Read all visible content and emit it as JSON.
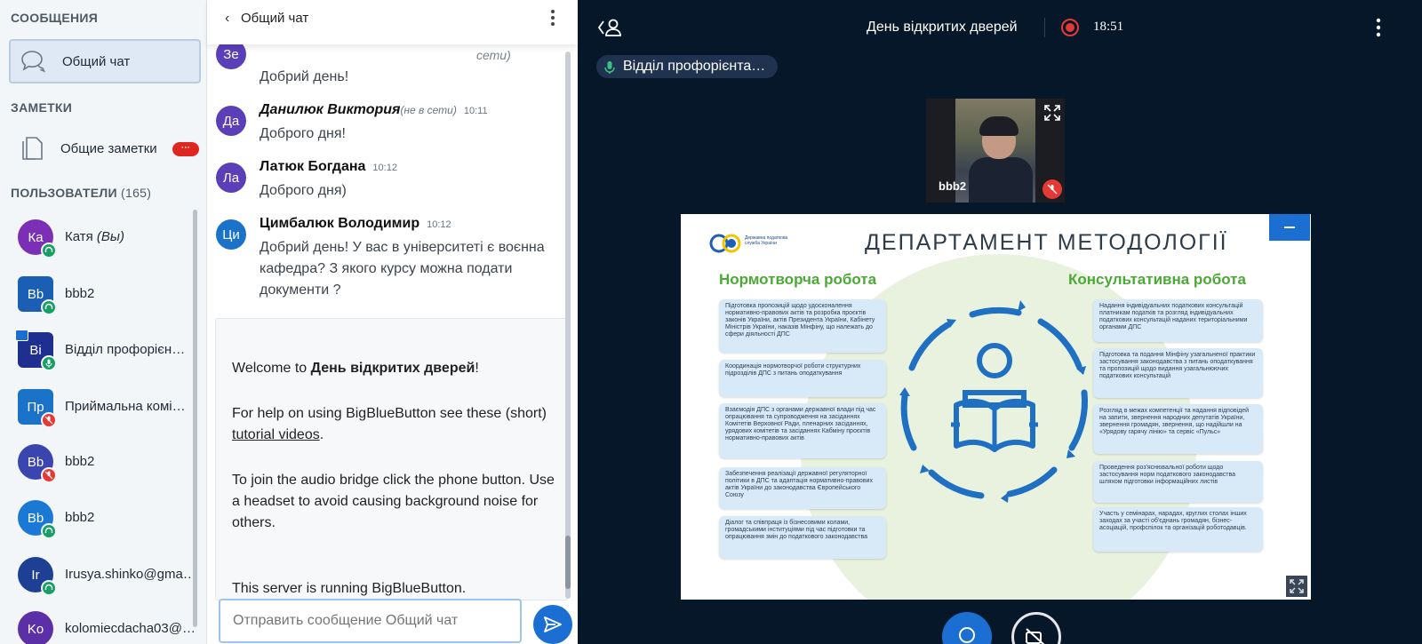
{
  "sidebar": {
    "messages_title": "СООБЩЕНИЯ",
    "public_chat": "Общий чат",
    "notes_title": "ЗАМЕТКИ",
    "shared_notes": "Общие заметки",
    "notes_badge": "···",
    "users_title": "ПОЛЬЗОВАТЕЛИ",
    "users_count": "(165)",
    "users": [
      {
        "initials": "Ка",
        "name": "Катя",
        "suffix": "(Вы)",
        "color": "#7b2fb5"
      },
      {
        "initials": "Bb",
        "name": "bbb2",
        "suffix": "",
        "color": "#1a5fb4"
      },
      {
        "initials": "Ві",
        "name": "Відділ профорієн…",
        "suffix": "",
        "color": "#1f2f8f"
      },
      {
        "initials": "Пр",
        "name": "Приймальна комі…",
        "suffix": "",
        "color": "#1a73c8"
      },
      {
        "initials": "Bb",
        "name": "bbb2",
        "suffix": "",
        "color": "#3b45b0"
      },
      {
        "initials": "Bb",
        "name": "bbb2",
        "suffix": "",
        "color": "#1b79d6"
      },
      {
        "initials": "Ir",
        "name": "Irusya.shinko@gma…",
        "suffix": "",
        "color": "#1d3f94"
      },
      {
        "initials": "Ko",
        "name": "kolomiecdacha03@…",
        "suffix": "",
        "color": "#5b2fa5"
      }
    ]
  },
  "chat": {
    "title": "Общий чат",
    "messages": [
      {
        "initials": "Зе",
        "author": "",
        "offline": "сети)",
        "time": "",
        "lines": [
          "Добрий день!"
        ]
      },
      {
        "initials": "Да",
        "author": "Данилюк Виктория",
        "offline": "(не в сети)",
        "time": "10:11",
        "lines": [
          "Доброго дня!"
        ]
      },
      {
        "initials": "Ла",
        "author": "Латюк Богдана",
        "offline": "",
        "time": "10:12",
        "lines": [
          "Доброго дня)"
        ]
      },
      {
        "initials": "Ци",
        "author": "Цимбалюк Володимир",
        "offline": "",
        "time": "10:12",
        "lines": [
          "Добрий день! У вас в університеті є воєнна",
          "кафедра? З якого курсу можна подати",
          "документи ?"
        ]
      }
    ],
    "welcome": {
      "w1a": "Welcome to ",
      "w1b": "День відкритих дверей",
      "w1c": "!",
      "w2a": "For help on using BigBlueButton see these (short) ",
      "w2b": "tutorial videos",
      "w2c": ".",
      "w3": "To join the audio bridge click the phone button. Use a headset to avoid causing background noise for others.",
      "w4": "This server is running BigBlueButton."
    },
    "input_placeholder": "Отправить сообщение Общий чат"
  },
  "main": {
    "meeting_title": "День відкритих дверей",
    "time": "18:51",
    "talker": "Відділ профорієнта…",
    "camera_name": "bbb2"
  },
  "slide": {
    "logo_text": "Державна податкова служба України",
    "title": "ДЕПАРТАМЕНТ МЕТОДОЛОГІЇ",
    "left_heading": "Нормотворча робота",
    "right_heading": "Консультативна робота",
    "left_boxes": [
      "Підготовка пропозицій щодо удосконалення нормативно-правових актів та розробка проєктів законів України, актів Президента України, Кабінету Міністрів України, наказів Мінфіну, що належать до сфери діяльності ДПС",
      "Координація нормотворчої роботи структурних підрозділів ДПС з питань оподаткування",
      "Взаємодія ДПС з органами державної влади під час опрацювання та супроводження на засіданнях Комітетів Верховної Ради, пленарних засіданнях, урядових комітетів та засіданнях Кабміну проєктів нормативно-правових актів",
      "Забезпечення реалізації державної регуляторної політики в ДПС та адаптація нормативно-правових актів України до законодавства Європейського Союзу",
      "Діалог та співпраця із бізнесовими колами, громадськими інституціями під час підготовки та опрацювання змін до податкового законодавства"
    ],
    "right_boxes": [
      "Надання індивідуальних податкових консультацій платникам податків та розгляд індивідуальних податкових консультацій наданих територіальними органами ДПС",
      "Підготовка та подання Мінфіну узагальненої практики застосування законодавства з питань оподаткування та пропозицій щодо видання узагальнюючих податкових консультацій",
      "Розгляд в межах компетенції та надання відповідей на запити, звернення народних депутатів України, звернення громадян, звернення, що надійшли на «Урядову гарячу лінію» та сервіс «Пульс»",
      "Проведення роз'яснювальної роботи щодо застосування норм податкового законодавства шляхом підготовки інформаційних листів",
      "Участь у семінарах, нарадах, круглих столах інших заходах за участі об'єднань громадян, бізнес-асоціацій, профспілок та організацій роботодавців."
    ]
  },
  "colors": {
    "accent": "#1b6fd2",
    "dark_bg": "#06172a",
    "record": "#e53935",
    "slide_green": "#4aaa35"
  }
}
